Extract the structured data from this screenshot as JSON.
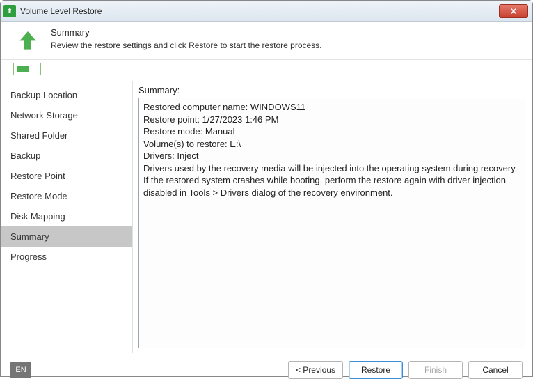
{
  "titlebar": {
    "title": "Volume Level Restore"
  },
  "header": {
    "title": "Summary",
    "subtitle": "Review the restore settings and click Restore to start the restore process."
  },
  "sidebar": {
    "items": [
      "Backup Location",
      "Network Storage",
      "Shared Folder",
      "Backup",
      "Restore Point",
      "Restore Mode",
      "Disk Mapping",
      "Summary",
      "Progress"
    ],
    "activeIndex": 7
  },
  "main": {
    "label": "Summary:",
    "lines": {
      "l0": "Restored computer name: WINDOWS11",
      "l1": "Restore point: 1/27/2023 1:46 PM",
      "l2": "Restore mode: Manual",
      "l3": "Volume(s) to restore: E:\\",
      "l4": "Drivers: Inject",
      "l5": "Drivers used by the recovery media will be injected into the operating system during recovery. If the restored system crashes while booting, perform the restore again with driver injection disabled in Tools > Drivers dialog of the recovery environment."
    }
  },
  "footer": {
    "lang": "EN",
    "previous": "< Previous",
    "restore": "Restore",
    "finish": "Finish",
    "cancel": "Cancel"
  }
}
